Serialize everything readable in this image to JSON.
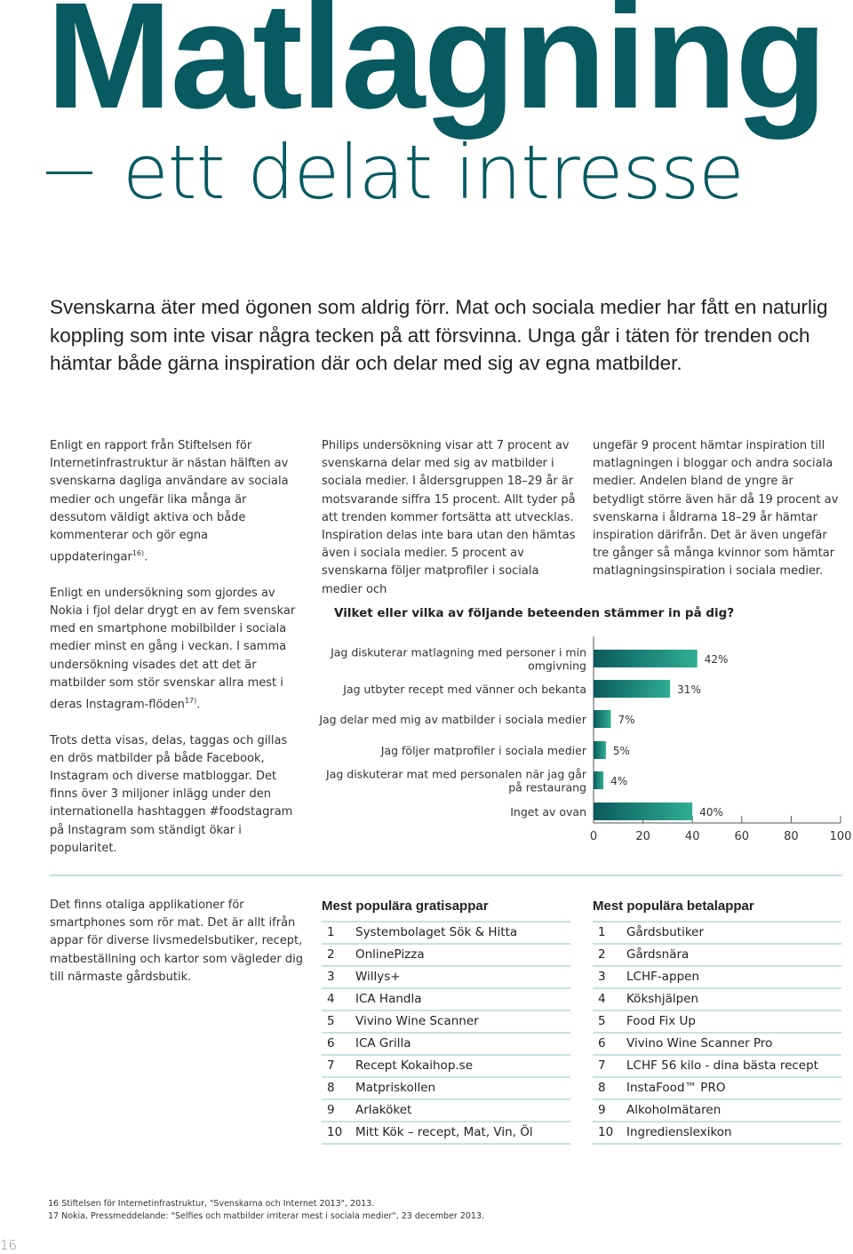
{
  "header": {
    "title": "Matlagning",
    "subtitle": "ett delat intresse"
  },
  "lead": "Svenskarna äter med ögonen som aldrig förr. Mat och sociala medier har fått en naturlig koppling som inte visar några tecken på att försvinna. Unga går i täten för trenden och hämtar både gärna inspiration där och delar med sig av egna matbilder.",
  "columns": {
    "left": [
      {
        "text": "Enligt en rapport från Stiftelsen för Internetinfrastruktur är nästan hälften av svenskarna dagliga användare av sociala medier och ungefär lika många är dessutom väldigt aktiva och både kommenterar och gör egna uppdateringar",
        "sup": "16)",
        "end": "."
      },
      {
        "text": "Enligt en undersökning som gjordes av Nokia i fjol delar drygt en av fem svenskar med en smartphone mobilbilder i sociala medier minst en gång i veckan. I samma undersökning visades det att det är matbilder som stör svenskar allra mest i deras Instagram-flöden",
        "sup": "17)",
        "end": "."
      },
      {
        "text": "Trots detta visas, delas, taggas och gillas en drös matbilder på både Facebook, Instagram och diverse matbloggar. Det finns över 3 miljoner inlägg under den internationella hashtaggen #foodstagram på Instagram som ständigt ökar i popularitet."
      }
    ],
    "middle": "Philips undersökning visar att 7 procent av svenskarna delar med sig av matbilder i sociala medier. I åldersgruppen 18–29 år är motsvarande siffra 15 procent. Allt tyder på att trenden kommer fortsätta att utvecklas. Inspiration delas inte bara utan den hämtas även i sociala medier. 5 procent av svenskarna följer matprofiler i sociala medier och",
    "right": "ungefär 9 procent hämtar inspiration till matlagningen i bloggar och andra sociala medier. Andelen bland de yngre är betydligt större även här då 19 procent av svenskarna i åldrarna 18–29 år hämtar inspiration därifrån. Det är även ungefär tre gånger så många kvinnor som hämtar matlagningsinspiration i sociala medier."
  },
  "chart_data": {
    "type": "bar",
    "orientation": "horizontal",
    "title": "Vilket eller vilka av följande beteenden stämmer in på dig?",
    "categories": [
      "Jag diskuterar matlagning med personer i min omgivning",
      "Jag utbyter recept med vänner och bekanta",
      "Jag delar med mig av matbilder i sociala medier",
      "Jag följer matprofiler i sociala medier",
      "Jag diskuterar mat med personalen när jag går på restaurang",
      "Inget av ovan"
    ],
    "category_lines": [
      [
        "Jag diskuterar matlagning med personer i min",
        "omgivning"
      ],
      [
        "Jag utbyter recept med vänner och bekanta"
      ],
      [
        "Jag delar med mig av matbilder i sociala medier"
      ],
      [
        "Jag följer matprofiler i sociala medier"
      ],
      [
        "Jag diskuterar mat med personalen när jag går",
        "på restaurang"
      ],
      [
        "Inget av ovan"
      ]
    ],
    "values": [
      42,
      31,
      7,
      5,
      4,
      40
    ],
    "value_labels": [
      "42%",
      "31%",
      "7%",
      "5%",
      "4%",
      "40%"
    ],
    "xlim": [
      0,
      100
    ],
    "xticks": [
      0,
      20,
      40,
      60,
      80,
      100
    ],
    "xlabel": "",
    "ylabel": "",
    "grid": false,
    "legend": "none",
    "colors": {
      "bar_start": "#0b5a5d",
      "bar_end": "#2fae94",
      "axis": "#555555"
    }
  },
  "apps": {
    "intro": "Det finns otaliga applikationer för smartphones som rör mat. Det är allt ifrån appar för diverse livsmedelsbutiker, recept, matbeställning och kartor som vägleder dig till närmaste gårdsbutik.",
    "free": {
      "heading": "Mest populära gratisappar",
      "items": [
        {
          "rank": "1",
          "name": "Systembolaget Sök & Hitta"
        },
        {
          "rank": "2",
          "name": "OnlinePizza"
        },
        {
          "rank": "3",
          "name": "Willys+"
        },
        {
          "rank": "4",
          "name": "ICA Handla"
        },
        {
          "rank": "5",
          "name": "Vivino Wine Scanner"
        },
        {
          "rank": "6",
          "name": "ICA Grilla"
        },
        {
          "rank": "7",
          "name": "Recept Kokaihop.se"
        },
        {
          "rank": "8",
          "name": "Matpriskollen"
        },
        {
          "rank": "9",
          "name": "Arlaköket"
        },
        {
          "rank": "10",
          "name": "Mitt Kök – recept, Mat, Vin, Öl"
        }
      ]
    },
    "paid": {
      "heading": "Mest populära betalappar",
      "items": [
        {
          "rank": "1",
          "name": "Gårdsbutiker"
        },
        {
          "rank": "2",
          "name": "Gårdsnära"
        },
        {
          "rank": "3",
          "name": "LCHF-appen"
        },
        {
          "rank": "4",
          "name": "Kökshjälpen"
        },
        {
          "rank": "5",
          "name": "Food Fix Up"
        },
        {
          "rank": "6",
          "name": "Vivino Wine Scanner Pro"
        },
        {
          "rank": "7",
          "name": "LCHF 56 kilo - dina bästa recept"
        },
        {
          "rank": "8",
          "name": "InstaFood™ PRO"
        },
        {
          "rank": "9",
          "name": "Alkoholmätaren"
        },
        {
          "rank": "10",
          "name": "Ingredienslexikon"
        }
      ]
    }
  },
  "footnotes": [
    "16 Stiftelsen för Internetinfrastruktur, \"Svenskarna och Internet 2013\", 2013.",
    "17 Nokia, Pressmeddelande: \"Selfies och matbilder irriterar mest i sociala medier\", 23 december 2013."
  ],
  "page_number": "16",
  "colors": {
    "brand": "#065a60",
    "rule": "#c6e2e2"
  }
}
